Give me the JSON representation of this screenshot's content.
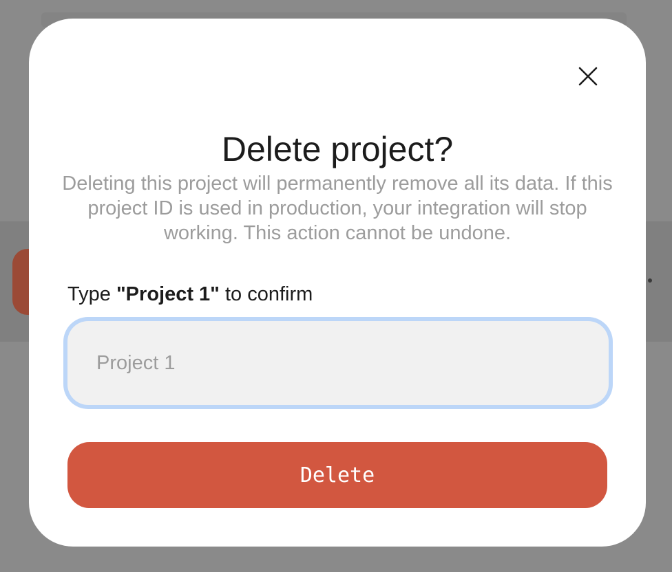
{
  "dialog": {
    "title": "Delete project?",
    "description": "Deleting this project will permanently remove all its data. If this project ID is used in production, your integration will stop working. This action cannot be undone.",
    "confirm_label_prefix": "Type ",
    "confirm_label_project": "\"Project 1\"",
    "confirm_label_suffix": " to confirm",
    "input": {
      "value": "",
      "placeholder": "Project 1"
    },
    "delete_button_label": "Delete",
    "close_icon": "close-icon"
  },
  "colors": {
    "overlay": "#8a8a8a",
    "danger": "#d25740",
    "focus_ring": "#bcd6f8",
    "muted_text": "#9c9c9c"
  }
}
